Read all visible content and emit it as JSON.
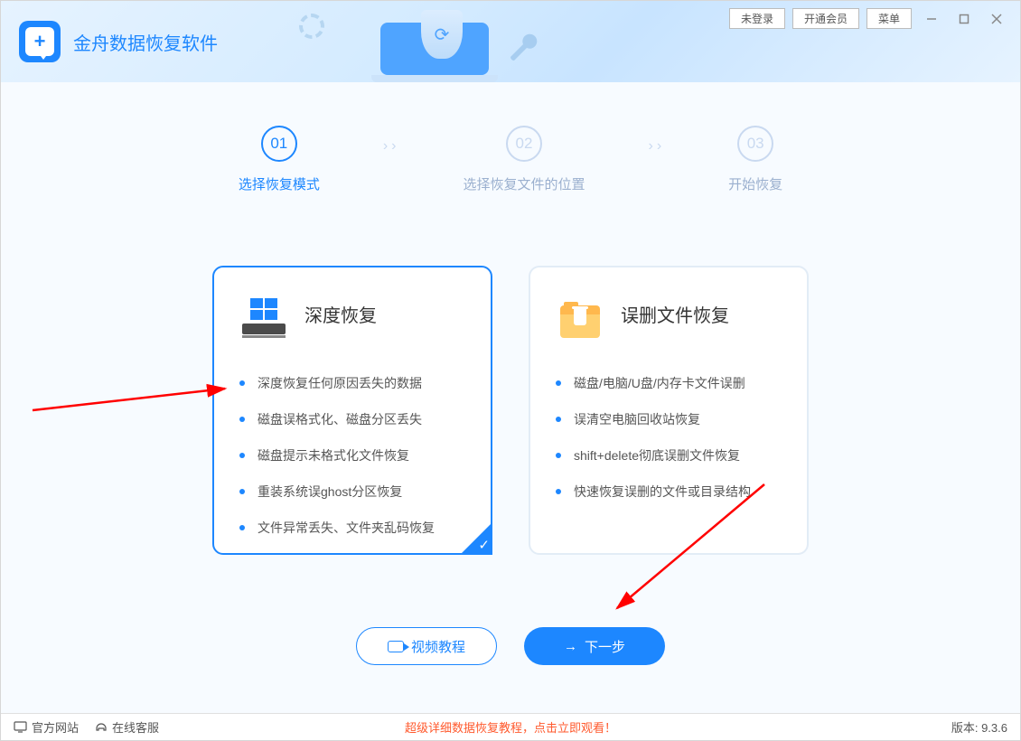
{
  "app": {
    "title": "金舟数据恢复软件"
  },
  "titlebar": {
    "not_logged_in": "未登录",
    "open_vip": "开通会员",
    "menu": "菜单"
  },
  "steps": {
    "list": [
      {
        "num": "01",
        "label": "选择恢复模式",
        "active": true
      },
      {
        "num": "02",
        "label": "选择恢复文件的位置",
        "active": false
      },
      {
        "num": "03",
        "label": "开始恢复",
        "active": false
      }
    ]
  },
  "cards": {
    "deep": {
      "title": "深度恢复",
      "items": [
        "深度恢复任何原因丢失的数据",
        "磁盘误格式化、磁盘分区丢失",
        "磁盘提示未格式化文件恢复",
        "重装系统误ghost分区恢复",
        "文件异常丢失、文件夹乱码恢复"
      ]
    },
    "deleted": {
      "title": "误删文件恢复",
      "items": [
        "磁盘/电脑/U盘/内存卡文件误删",
        "误清空电脑回收站恢复",
        "shift+delete彻底误删文件恢复",
        "快速恢复误删的文件或目录结构"
      ]
    }
  },
  "actions": {
    "video": "视频教程",
    "next": "下一步"
  },
  "footer": {
    "official": "官方网站",
    "support": "在线客服",
    "promo": "超级详细数据恢复教程，点击立即观看！",
    "version_label": "版本: ",
    "version": "9.3.6"
  }
}
